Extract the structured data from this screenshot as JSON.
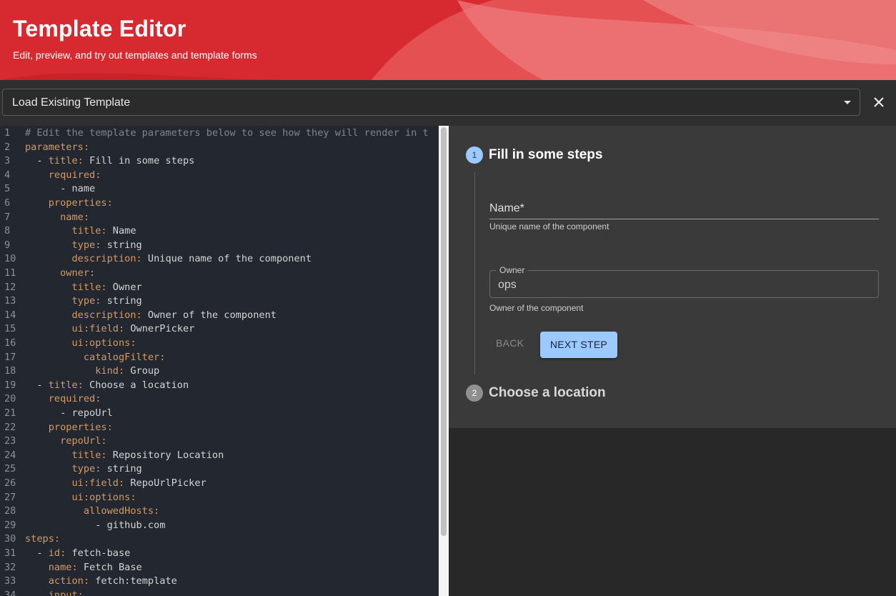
{
  "header": {
    "title": "Template Editor",
    "subtitle": "Edit, preview, and try out templates and template forms"
  },
  "template_select": {
    "value": "Load Existing Template"
  },
  "editor": {
    "lines": [
      {
        "n": "1",
        "indent": "",
        "key": "",
        "text": "# Edit the template parameters below to see how they will render in t",
        "comment": true
      },
      {
        "n": "2",
        "indent": "",
        "key": "parameters:",
        "text": ""
      },
      {
        "n": "3",
        "indent": "  - ",
        "key": "title:",
        "text": " Fill in some steps"
      },
      {
        "n": "4",
        "indent": "    ",
        "key": "required:",
        "text": ""
      },
      {
        "n": "5",
        "indent": "      ",
        "key": "",
        "text": "- name"
      },
      {
        "n": "6",
        "indent": "    ",
        "key": "properties:",
        "text": ""
      },
      {
        "n": "7",
        "indent": "      ",
        "key": "name:",
        "text": ""
      },
      {
        "n": "8",
        "indent": "        ",
        "key": "title:",
        "text": " Name"
      },
      {
        "n": "9",
        "indent": "        ",
        "key": "type:",
        "text": " string"
      },
      {
        "n": "10",
        "indent": "        ",
        "key": "description:",
        "text": " Unique name of the component"
      },
      {
        "n": "11",
        "indent": "      ",
        "key": "owner:",
        "text": ""
      },
      {
        "n": "12",
        "indent": "        ",
        "key": "title:",
        "text": " Owner"
      },
      {
        "n": "13",
        "indent": "        ",
        "key": "type:",
        "text": " string"
      },
      {
        "n": "14",
        "indent": "        ",
        "key": "description:",
        "text": " Owner of the component"
      },
      {
        "n": "15",
        "indent": "        ",
        "key": "ui:field:",
        "text": " OwnerPicker"
      },
      {
        "n": "16",
        "indent": "        ",
        "key": "ui:options:",
        "text": ""
      },
      {
        "n": "17",
        "indent": "          ",
        "key": "catalogFilter:",
        "text": ""
      },
      {
        "n": "18",
        "indent": "            ",
        "key": "kind:",
        "text": " Group"
      },
      {
        "n": "19",
        "indent": "  - ",
        "key": "title:",
        "text": " Choose a location"
      },
      {
        "n": "20",
        "indent": "    ",
        "key": "required:",
        "text": ""
      },
      {
        "n": "21",
        "indent": "      ",
        "key": "",
        "text": "- repoUrl"
      },
      {
        "n": "22",
        "indent": "    ",
        "key": "properties:",
        "text": ""
      },
      {
        "n": "23",
        "indent": "      ",
        "key": "repoUrl:",
        "text": ""
      },
      {
        "n": "24",
        "indent": "        ",
        "key": "title:",
        "text": " Repository Location"
      },
      {
        "n": "25",
        "indent": "        ",
        "key": "type:",
        "text": " string"
      },
      {
        "n": "26",
        "indent": "        ",
        "key": "ui:field:",
        "text": " RepoUrlPicker"
      },
      {
        "n": "27",
        "indent": "        ",
        "key": "ui:options:",
        "text": ""
      },
      {
        "n": "28",
        "indent": "          ",
        "key": "allowedHosts:",
        "text": ""
      },
      {
        "n": "29",
        "indent": "            ",
        "key": "",
        "text": "- github.com"
      },
      {
        "n": "30",
        "indent": "",
        "key": "steps:",
        "text": ""
      },
      {
        "n": "31",
        "indent": "  - ",
        "key": "id:",
        "text": " fetch-base"
      },
      {
        "n": "32",
        "indent": "    ",
        "key": "name:",
        "text": " Fetch Base"
      },
      {
        "n": "33",
        "indent": "    ",
        "key": "action:",
        "text": " fetch:template"
      },
      {
        "n": "34",
        "indent": "    ",
        "key": "input:",
        "text": ""
      }
    ]
  },
  "preview": {
    "step1": {
      "number": "1",
      "title": "Fill in some steps"
    },
    "step2": {
      "number": "2",
      "title": "Choose a location"
    },
    "name_field": {
      "label": "Name*",
      "helper": "Unique name of the component"
    },
    "owner_field": {
      "label": "Owner",
      "value": "ops",
      "helper": "Owner of the component"
    },
    "back_label": "BACK",
    "next_label": "NEXT STEP"
  },
  "colors": {
    "header_red": "#d4252d",
    "editor_bg": "#232830",
    "yaml_key": "#d19a66",
    "primary_button": "#9cc9ff"
  }
}
